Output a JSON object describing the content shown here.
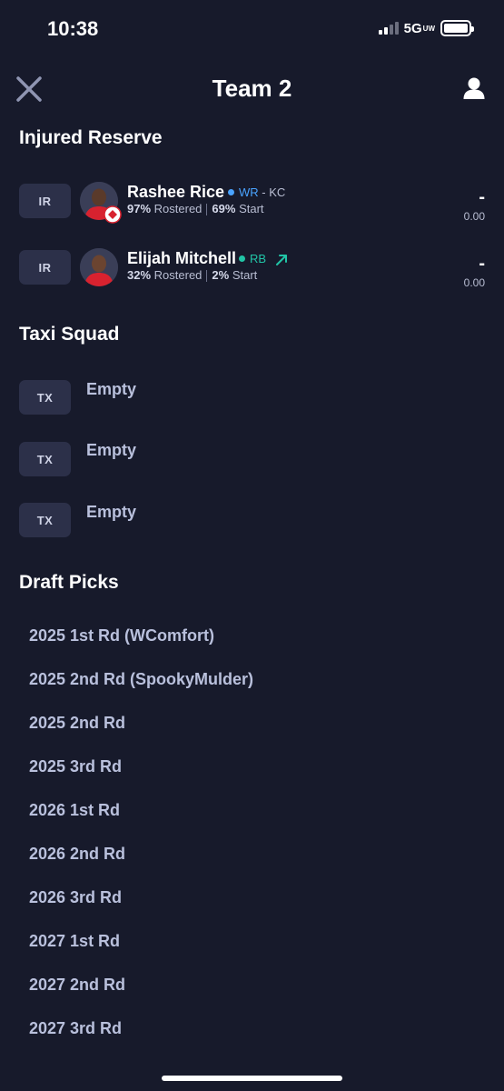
{
  "status_bar": {
    "time": "10:38",
    "network": "5G",
    "network_sub": "UW"
  },
  "header": {
    "title": "Team 2"
  },
  "injured_reserve": {
    "title": "Injured Reserve",
    "players": [
      {
        "slot": "IR",
        "name": "Rashee Rice",
        "position": "WR",
        "team": "- KC",
        "pos_color": "#4aa3ff",
        "rostered_pct": "97%",
        "rostered_label": "Rostered",
        "start_pct": "69%",
        "start_label": "Start",
        "proj": "-",
        "pts": "0.00"
      },
      {
        "slot": "IR",
        "name": "Elijah Mitchell",
        "position": "RB",
        "team": "",
        "pos_color": "#21c4a6",
        "rostered_pct": "32%",
        "rostered_label": "Rostered",
        "start_pct": "2%",
        "start_label": "Start",
        "proj": "-",
        "pts": "0.00",
        "trend_icon": "trending-up-icon"
      }
    ]
  },
  "taxi_squad": {
    "title": "Taxi Squad",
    "slots": [
      {
        "slot": "TX",
        "label": "Empty"
      },
      {
        "slot": "TX",
        "label": "Empty"
      },
      {
        "slot": "TX",
        "label": "Empty"
      }
    ]
  },
  "draft_picks": {
    "title": "Draft Picks",
    "picks": [
      "2025 1st Rd (WComfort)",
      "2025 2nd Rd (SpookyMulder)",
      "2025 2nd Rd",
      "2025 3rd Rd",
      "2026 1st Rd",
      "2026 2nd Rd",
      "2026 3rd Rd",
      "2027 1st Rd",
      "2027 2nd Rd",
      "2027 3rd Rd"
    ]
  },
  "colors": {
    "background": "#171a2b",
    "badge": "#2c3049",
    "pick_text": "#b9c0dc",
    "wr_accent": "#4aa3ff",
    "rb_accent": "#21c4a6"
  }
}
